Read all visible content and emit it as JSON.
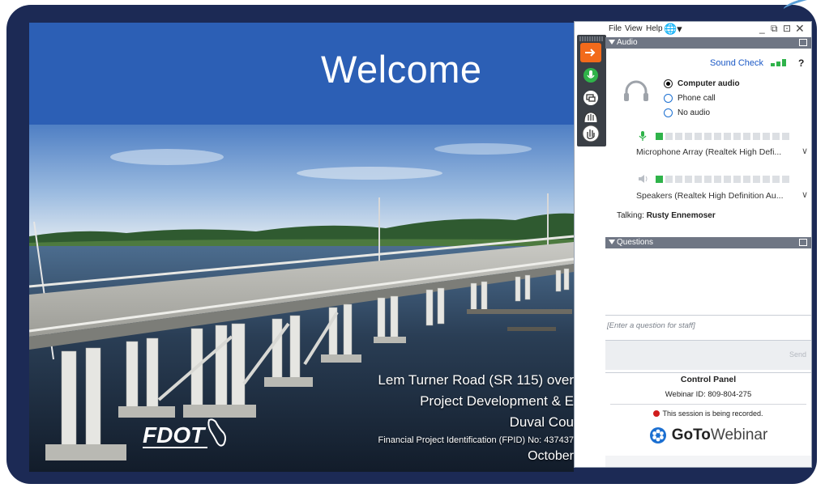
{
  "slide": {
    "title": "Welcome",
    "caption_line1": "Lem Turner Road (SR 115) over",
    "caption_line2": "Project Development & E",
    "caption_line3": "Duval Cou",
    "caption_line4": "Financial Project Identification (FPID) No: 437437",
    "caption_line5": "October",
    "logo_text": "FDOT"
  },
  "panel": {
    "menu": [
      "File",
      "View",
      "Help"
    ],
    "audio_section_label": "Audio",
    "sound_check_label": "Sound Check",
    "help_label": "?",
    "audio_options": [
      {
        "label": "Computer audio",
        "selected": true
      },
      {
        "label": "Phone call",
        "selected": false
      },
      {
        "label": "No audio",
        "selected": false
      }
    ],
    "mic_level": 1,
    "speaker_level": 1,
    "level_segments": 14,
    "microphone_device": "Microphone Array (Realtek High Defi...",
    "speaker_device": "Speakers (Realtek High Definition Au...",
    "talking_label": "Talking:",
    "talking_name": "Rusty Ennemoser",
    "questions_section_label": "Questions",
    "question_placeholder": "[Enter a question for staff]",
    "send_label": "Send",
    "control_panel_title": "Control Panel",
    "webinar_id": "Webinar ID: 809-804-275",
    "recording_notice": "This session is being recorded.",
    "brand_goto": "GoTo",
    "brand_webinar": "Webinar"
  },
  "colors": {
    "frame": "#1c2a55",
    "slide_header": "#2c5fb5",
    "section_bar": "#6f7684",
    "link_blue": "#1b59c6",
    "level_green": "#2fb34a",
    "record_red": "#d01c1c"
  }
}
